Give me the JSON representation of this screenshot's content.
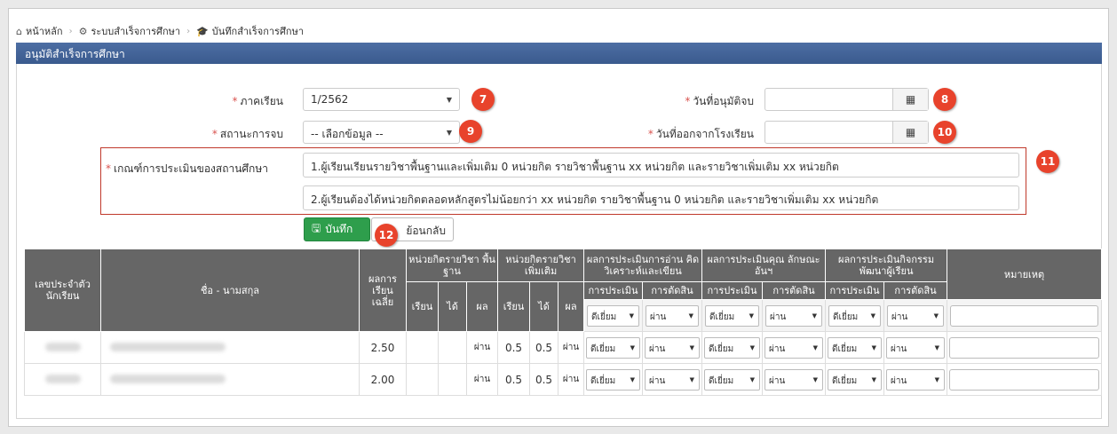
{
  "breadcrumb": {
    "home": "หน้าหลัก",
    "system": "ระบบสำเร็จการศึกษา",
    "current": "บันทึกสำเร็จการศึกษา"
  },
  "panel": {
    "title": "อนุมัติสำเร็จการศึกษา"
  },
  "form": {
    "semester_label": "ภาคเรียน",
    "semester_value": "1/2562",
    "status_label": "สถานะการจบ",
    "status_value": "-- เลือกข้อมูล --",
    "approve_date_label": "วันที่อนุมัติจบ",
    "leave_date_label": "วันที่ออกจากโรงเรียน",
    "criteria_label": "เกณฑ์การประเมินของสถานศึกษา",
    "criteria_1": "1.ผู้เรียนเรียนรายวิชาพื้นฐานและเพิ่มเติม 0 หน่วยกิต รายวิชาพื้นฐาน xx หน่วยกิต และรายวิชาเพิ่มเติม xx หน่วยกิต",
    "criteria_2": "2.ผู้เรียนต้องได้หน่วยกิตตลอดหลักสูตรไม่น้อยกว่า  xx หน่วยกิต รายวิชาพื้นฐาน 0 หน่วยกิต และรายวิชาเพิ่มเติม xx หน่วยกิต",
    "required_mark": "*"
  },
  "buttons": {
    "save": "บันทึก",
    "back": "ย้อนกลับ"
  },
  "badges": [
    "7",
    "8",
    "9",
    "10",
    "11",
    "12"
  ],
  "table": {
    "h_id": "เลขประจำตัว นักเรียน",
    "h_name": "ชื่อ - นามสกุล",
    "h_avg": "ผลการ เรียน เฉลี่ย",
    "h_basic": "หน่วยกิตรายวิชา พื้นฐาน",
    "h_extra": "หน่วยกิตรายวิชา เพิ่มเติม",
    "h_read": "ผลการประเมินการอ่าน คิดวิเคราะห์และเขียน",
    "h_char": "ผลการประเมินคุณ ลักษณะอันฯ",
    "h_act": "ผลการประเมินกิจกรรม พัฒนาผู้เรียน",
    "h_note": "หมายเหตุ",
    "h_study": "เรียน",
    "h_got": "ได้",
    "h_result": "ผล",
    "h_eval": "การประเมิน",
    "h_decide": "การตัดสิน",
    "filter_eval": "ดีเยี่ยม",
    "filter_decide": "ผ่าน",
    "rows": [
      {
        "avg": "2.50",
        "b_result": "ผ่าน",
        "e_study": "0.5",
        "e_got": "0.5",
        "e_result": "ผ่าน",
        "r_eval": "ดีเยี่ยม",
        "r_dec": "ผ่าน",
        "c_eval": "ดีเยี่ยม",
        "c_dec": "ผ่าน",
        "a_eval": "ดีเยี่ยม",
        "a_dec": "ผ่าน"
      },
      {
        "avg": "2.00",
        "b_result": "ผ่าน",
        "e_study": "0.5",
        "e_got": "0.5",
        "e_result": "ผ่าน",
        "r_eval": "ดีเยี่ยม",
        "r_dec": "ผ่าน",
        "c_eval": "ดีเยี่ยม",
        "c_dec": "ผ่าน",
        "a_eval": "ดีเยี่ยม",
        "a_dec": "ผ่าน"
      }
    ]
  },
  "icons": [
    "home-icon",
    "gears-icon",
    "graduation-cap-icon",
    "calendar-icon",
    "save-icon",
    "caret-down-icon"
  ]
}
